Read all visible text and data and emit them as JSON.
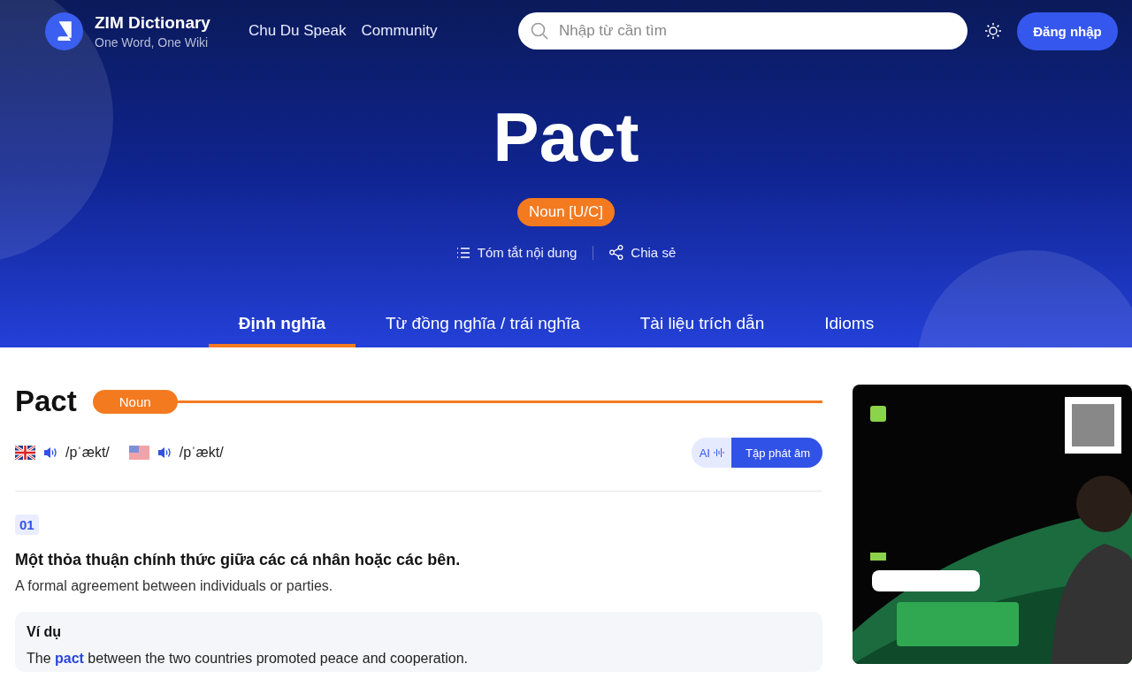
{
  "brand": {
    "name": "ZIM Dictionary",
    "tagline": "One Word, One Wiki"
  },
  "nav": [
    "Chu Du Speak",
    "Community"
  ],
  "search": {
    "placeholder": "Nhập từ cần tìm"
  },
  "login": "Đăng nhập",
  "hero": {
    "word": "Pact",
    "pos": "Noun [U/C]",
    "actions": [
      {
        "kind": "summary",
        "label": "Tóm tắt nội dung"
      },
      {
        "kind": "share",
        "label": "Chia sẻ"
      }
    ]
  },
  "tabs": [
    {
      "label": "Định nghĩa",
      "selected": true
    },
    {
      "label": "Từ đồng nghĩa / trái nghĩa",
      "selected": false
    },
    {
      "label": "Tài liệu trích dẫn",
      "selected": false
    },
    {
      "label": "Idioms",
      "selected": false
    }
  ],
  "entry": {
    "word": "Pact",
    "pos": "Noun",
    "pronunciations": [
      {
        "kind": "uk",
        "ipa": "/pˈækt/"
      },
      {
        "kind": "us",
        "ipa": "/pˈækt/"
      }
    ],
    "practice": {
      "ai": "AI",
      "label": "Tập phát âm"
    },
    "senses": [
      {
        "number": "01",
        "vi": "Một thỏa thuận chính thức giữa các cá nhân hoặc các bên.",
        "en": "A formal agreement between individuals or parties.",
        "example_title": "Ví dụ",
        "example": "The **pact** between the two countries promoted peace and cooperation."
      }
    ]
  }
}
